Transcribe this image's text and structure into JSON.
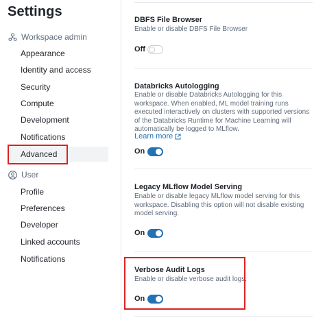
{
  "sidebar": {
    "title": "Settings",
    "workspace_admin": {
      "label": "Workspace admin",
      "icon": "workspace-admin-icon",
      "items": [
        {
          "label": "Appearance"
        },
        {
          "label": "Identity and access"
        },
        {
          "label": "Security"
        },
        {
          "label": "Compute"
        },
        {
          "label": "Development"
        },
        {
          "label": "Notifications"
        },
        {
          "label": "Advanced",
          "active": true
        }
      ]
    },
    "user": {
      "label": "User",
      "icon": "user-icon",
      "items": [
        {
          "label": "Profile"
        },
        {
          "label": "Preferences"
        },
        {
          "label": "Developer"
        },
        {
          "label": "Linked accounts"
        },
        {
          "label": "Notifications"
        }
      ]
    }
  },
  "main": {
    "settings": [
      {
        "title": "DBFS File Browser",
        "description": "Enable or disable DBFS File Browser",
        "state_label": "Off",
        "enabled": false
      },
      {
        "title": "Databricks Autologging",
        "description": "Enable or disable Databricks Autologging for this workspace. When enabled, ML model training runs executed interactively on clusters with supported versions of the Databricks Runtime for Machine Learning will automatically be logged to MLflow.",
        "link_label": "Learn more",
        "state_label": "On",
        "enabled": true
      },
      {
        "title": "Legacy MLflow Model Serving",
        "description": "Enable or disable legacy MLflow model serving for this workspace. Disabling this option will not disable existing model serving.",
        "state_label": "On",
        "enabled": true
      },
      {
        "title": "Verbose Audit Logs",
        "description": "Enable or disable verbose audit logs.",
        "state_label": "On",
        "enabled": true
      }
    ]
  },
  "colors": {
    "accent": "#2272b4",
    "highlight": "#e02020",
    "muted_text": "#5f6b7a"
  }
}
